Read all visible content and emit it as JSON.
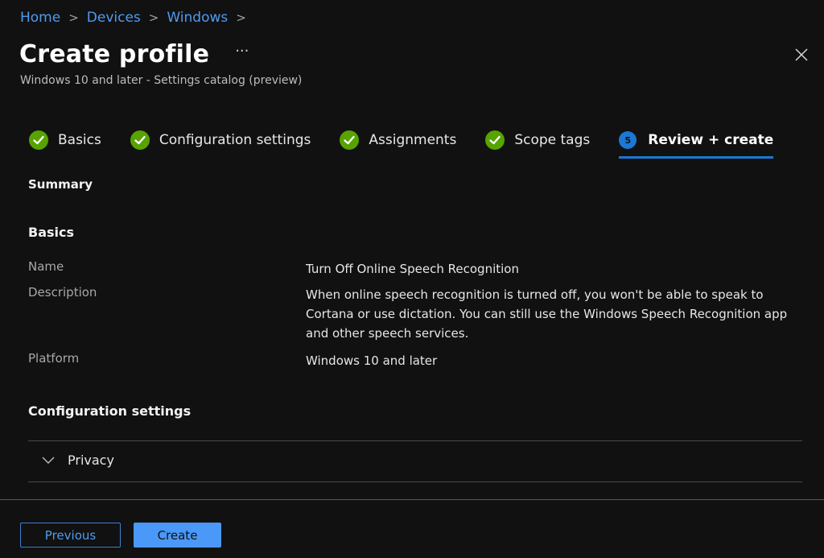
{
  "breadcrumb": {
    "items": [
      {
        "label": "Home"
      },
      {
        "label": "Devices"
      },
      {
        "label": "Windows"
      }
    ],
    "separator": ">"
  },
  "header": {
    "title": "Create profile",
    "more_label": "···",
    "subtitle": "Windows 10 and later - Settings catalog (preview)",
    "close_icon": "close-icon"
  },
  "wizard": {
    "steps": [
      {
        "label": "Basics",
        "status": "complete",
        "icon": "check-circle-icon"
      },
      {
        "label": "Configuration settings",
        "status": "complete",
        "icon": "check-circle-icon"
      },
      {
        "label": "Assignments",
        "status": "complete",
        "icon": "check-circle-icon"
      },
      {
        "label": "Scope tags",
        "status": "complete",
        "icon": "check-circle-icon"
      },
      {
        "label": "Review + create",
        "status": "active",
        "number": "5"
      }
    ],
    "colors": {
      "complete": "#57a300",
      "active": "#1a78d6"
    }
  },
  "summary": {
    "heading": "Summary",
    "basics": {
      "heading": "Basics",
      "fields": [
        {
          "label": "Name",
          "value": "Turn Off Online Speech Recognition"
        },
        {
          "label": "Description",
          "value": "When online speech recognition is turned off, you won't be able to speak to Cortana or use dictation. You can still use the Windows Speech Recognition app and other speech services."
        },
        {
          "label": "Platform",
          "value": "Windows 10 and later"
        }
      ]
    },
    "configuration": {
      "heading": "Configuration settings",
      "groups": [
        {
          "label": "Privacy",
          "expanded": false
        }
      ]
    }
  },
  "footer": {
    "previous_label": "Previous",
    "create_label": "Create"
  }
}
